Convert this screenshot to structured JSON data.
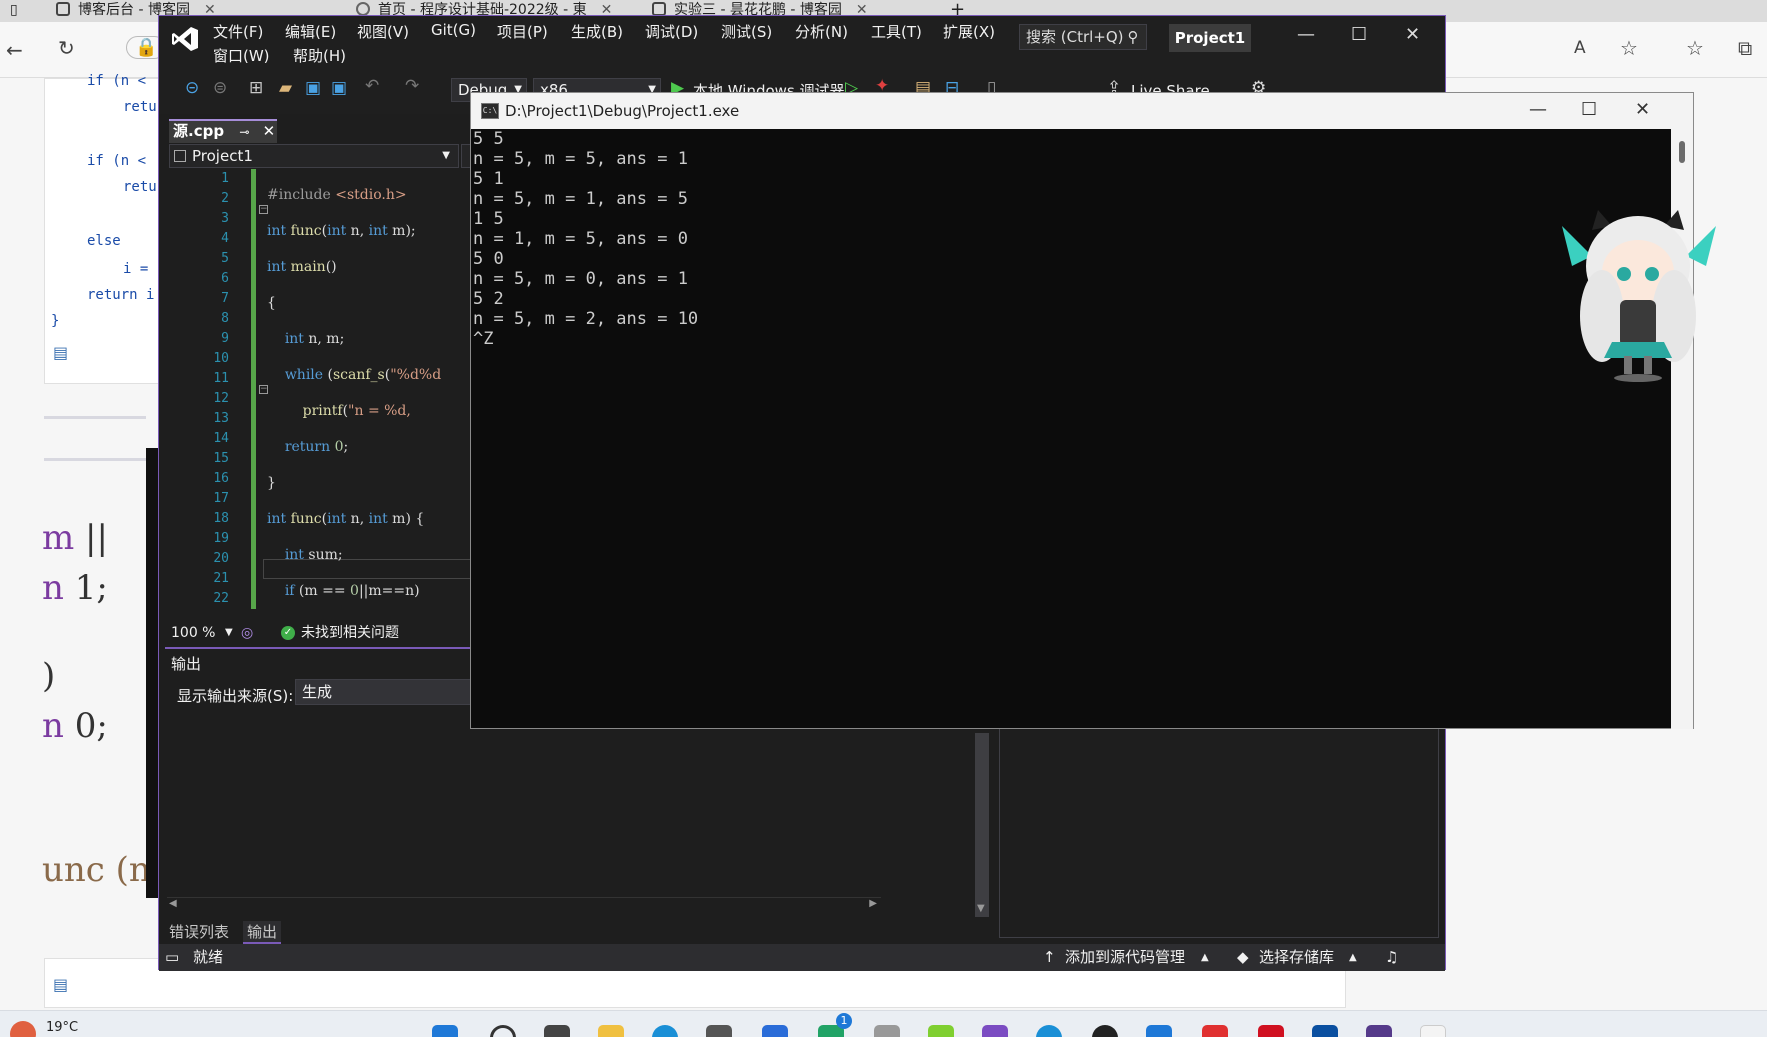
{
  "browser": {
    "tabs": [
      {
        "label": "博客后台 - 博客园"
      },
      {
        "label": "首页 - 程序设计基础-2022级 - 東"
      },
      {
        "label": "实验三 - 昙花花鹏 - 博客园"
      }
    ],
    "reading_icon": "read-aloud-icon"
  },
  "blog": {
    "code_lines": [
      "if (n <",
      "retu",
      "if (n <",
      "retu",
      "else",
      "i =",
      "return i",
      "}"
    ],
    "big_lines": [
      {
        "kw": "m",
        "rest": " || "
      },
      {
        "kw": "n",
        "rest": " 1;"
      },
      {
        "kw": "",
        "rest": ")"
      },
      {
        "kw": "n",
        "rest": " 0;"
      },
      {
        "kw": "",
        "rest": "unc (n"
      }
    ]
  },
  "taskbar": {
    "weather": "19°C",
    "badge": "1"
  },
  "vs": {
    "menus": [
      "文件(F)",
      "编辑(E)",
      "视图(V)",
      "Git(G)",
      "项目(P)",
      "生成(B)",
      "调试(D)",
      "测试(S)",
      "分析(N)",
      "工具(T)",
      "扩展(X)"
    ],
    "menus_row2": [
      "窗口(W)",
      "帮助(H)"
    ],
    "search": "搜索 (Ctrl+Q)",
    "project_name": "Project1",
    "toolbar": {
      "config": "Debug",
      "platform": "x86",
      "run_label": "本地 Windows 调试器",
      "live_share": "Live Share"
    },
    "doc_tab": "源.cpp",
    "nav_project": "Project1",
    "line_numbers": [
      "1",
      "2",
      "3",
      "4",
      "5",
      "6",
      "7",
      "8",
      "9",
      "10",
      "11",
      "12",
      "13",
      "14",
      "15",
      "16",
      "17",
      "18",
      "19",
      "20",
      "21",
      "22"
    ],
    "zoom": "100 %",
    "issues": "未找到相关问题",
    "output": {
      "title": "输出",
      "source_label": "显示输出来源(S):",
      "source_value": "生成"
    },
    "bottom_tabs": [
      "错误列表",
      "输出"
    ],
    "status": {
      "ready": "就绪",
      "add_source": "添加到源代码管理",
      "select_repo": "选择存储库"
    }
  },
  "console": {
    "title": "D:\\Project1\\Debug\\Project1.exe",
    "lines": [
      "5 5",
      "n = 5, m = 5, ans = 1",
      "5 1",
      "n = 5, m = 1, ans = 5",
      "1 5",
      "n = 1, m = 5, ans = 0",
      "5 0",
      "n = 5, m = 0, ans = 1",
      "5 2",
      "n = 5, m = 2, ans = 10",
      "^Z"
    ]
  },
  "colors": {
    "vs_accent": "#7a5ab8",
    "keyword": "#569cd6",
    "string": "#d69d85",
    "line_number": "#2b91af",
    "change_bar": "#57a64a"
  }
}
